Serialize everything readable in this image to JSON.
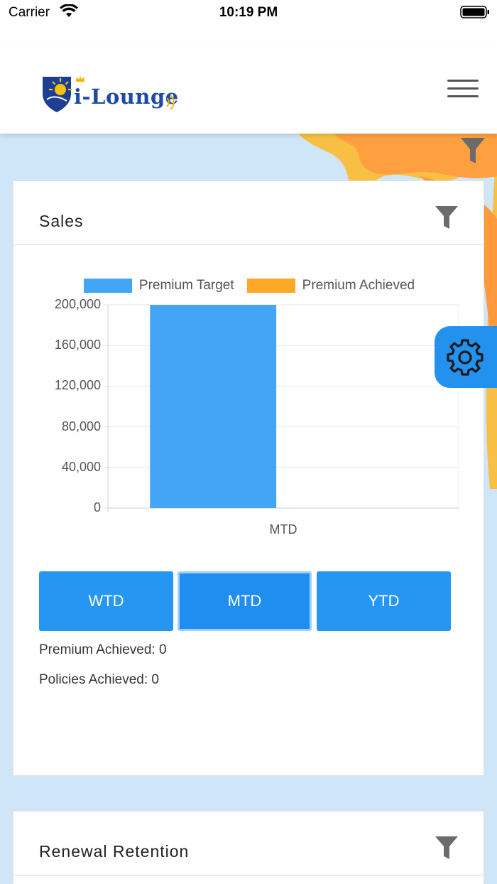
{
  "status_bar": {
    "carrier": "Carrier",
    "time": "10:19 PM"
  },
  "header": {
    "logo_text": "i-Lounge",
    "menu_icon": "hamburger-menu-icon"
  },
  "colors": {
    "target": "#42a5f5",
    "achieved": "#ffa726",
    "button": "#2597f3"
  },
  "sales": {
    "title": "Sales",
    "filter_icon": "filter-funnel-icon",
    "period_buttons": [
      {
        "label": "WTD"
      },
      {
        "label": "MTD"
      },
      {
        "label": "YTD"
      }
    ],
    "active_period": "MTD",
    "premium_achieved": "Premium Achieved: 0",
    "policies_achieved": "Policies Achieved: 0"
  },
  "chart_data": {
    "type": "bar",
    "categories": [
      "MTD"
    ],
    "series": [
      {
        "name": "Premium Target",
        "values": [
          200000
        ]
      },
      {
        "name": "Premium Achieved",
        "values": [
          0
        ]
      }
    ],
    "ylim": [
      0,
      200000
    ],
    "yticks": [
      "200,000",
      "160,000",
      "120,000",
      "80,000",
      "40,000",
      "0"
    ],
    "legend": "top",
    "grid": true
  },
  "renewal": {
    "title": "Renewal Retention",
    "filter_icon": "filter-funnel-icon"
  },
  "settings_fab": {
    "icon": "gear-icon"
  }
}
